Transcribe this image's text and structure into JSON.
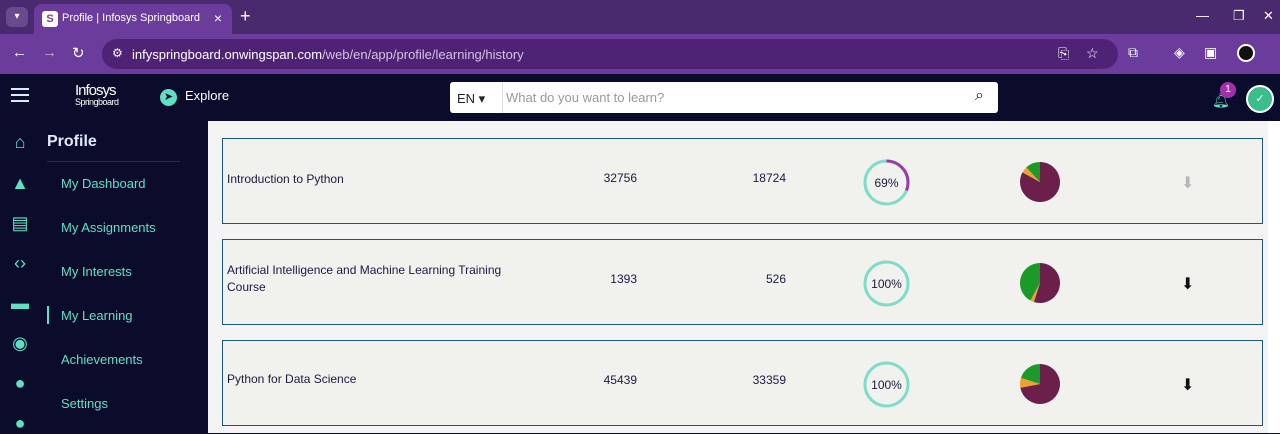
{
  "browser": {
    "tab_title": "Profile | Infosys Springboard",
    "url_host": "infyspringboard.onwingspan.com",
    "url_path": "/web/en/app/profile/learning/history"
  },
  "header": {
    "logo_line1": "Infosys",
    "logo_line2": "Springboard",
    "explore_label": "Explore",
    "lang_label": "EN",
    "search_placeholder": "What do you want to learn?",
    "notification_count": "1"
  },
  "sidebar": {
    "title": "Profile",
    "items": [
      {
        "label": "My Dashboard"
      },
      {
        "label": "My Assignments"
      },
      {
        "label": "My Interests"
      },
      {
        "label": "My Learning",
        "active": true
      },
      {
        "label": "Achievements"
      },
      {
        "label": "Settings"
      }
    ]
  },
  "courses": [
    {
      "name": "Introduction to Python",
      "num1": "32756",
      "num2": "18724",
      "progress_label": "69%",
      "progress": 0.69,
      "download_enabled": false,
      "pie": [
        0.83,
        0.05,
        0.12
      ]
    },
    {
      "name": "Artificial Intelligence and Machine Learning Training Course",
      "num1": "1393",
      "num2": "526",
      "progress_label": "100%",
      "progress": 1.0,
      "download_enabled": true,
      "pie": [
        0.55,
        0.03,
        0.42
      ]
    },
    {
      "name": "Python for Data Science",
      "num1": "45439",
      "num2": "33359",
      "progress_label": "100%",
      "progress": 1.0,
      "download_enabled": true,
      "pie": [
        0.72,
        0.08,
        0.2
      ]
    }
  ],
  "colors": {
    "accent": "#5fe0c0",
    "brand_purple": "#6c3c9c",
    "pie_slices": [
      "#6b1f4a",
      "#f0a030",
      "#1b9a2a"
    ]
  }
}
